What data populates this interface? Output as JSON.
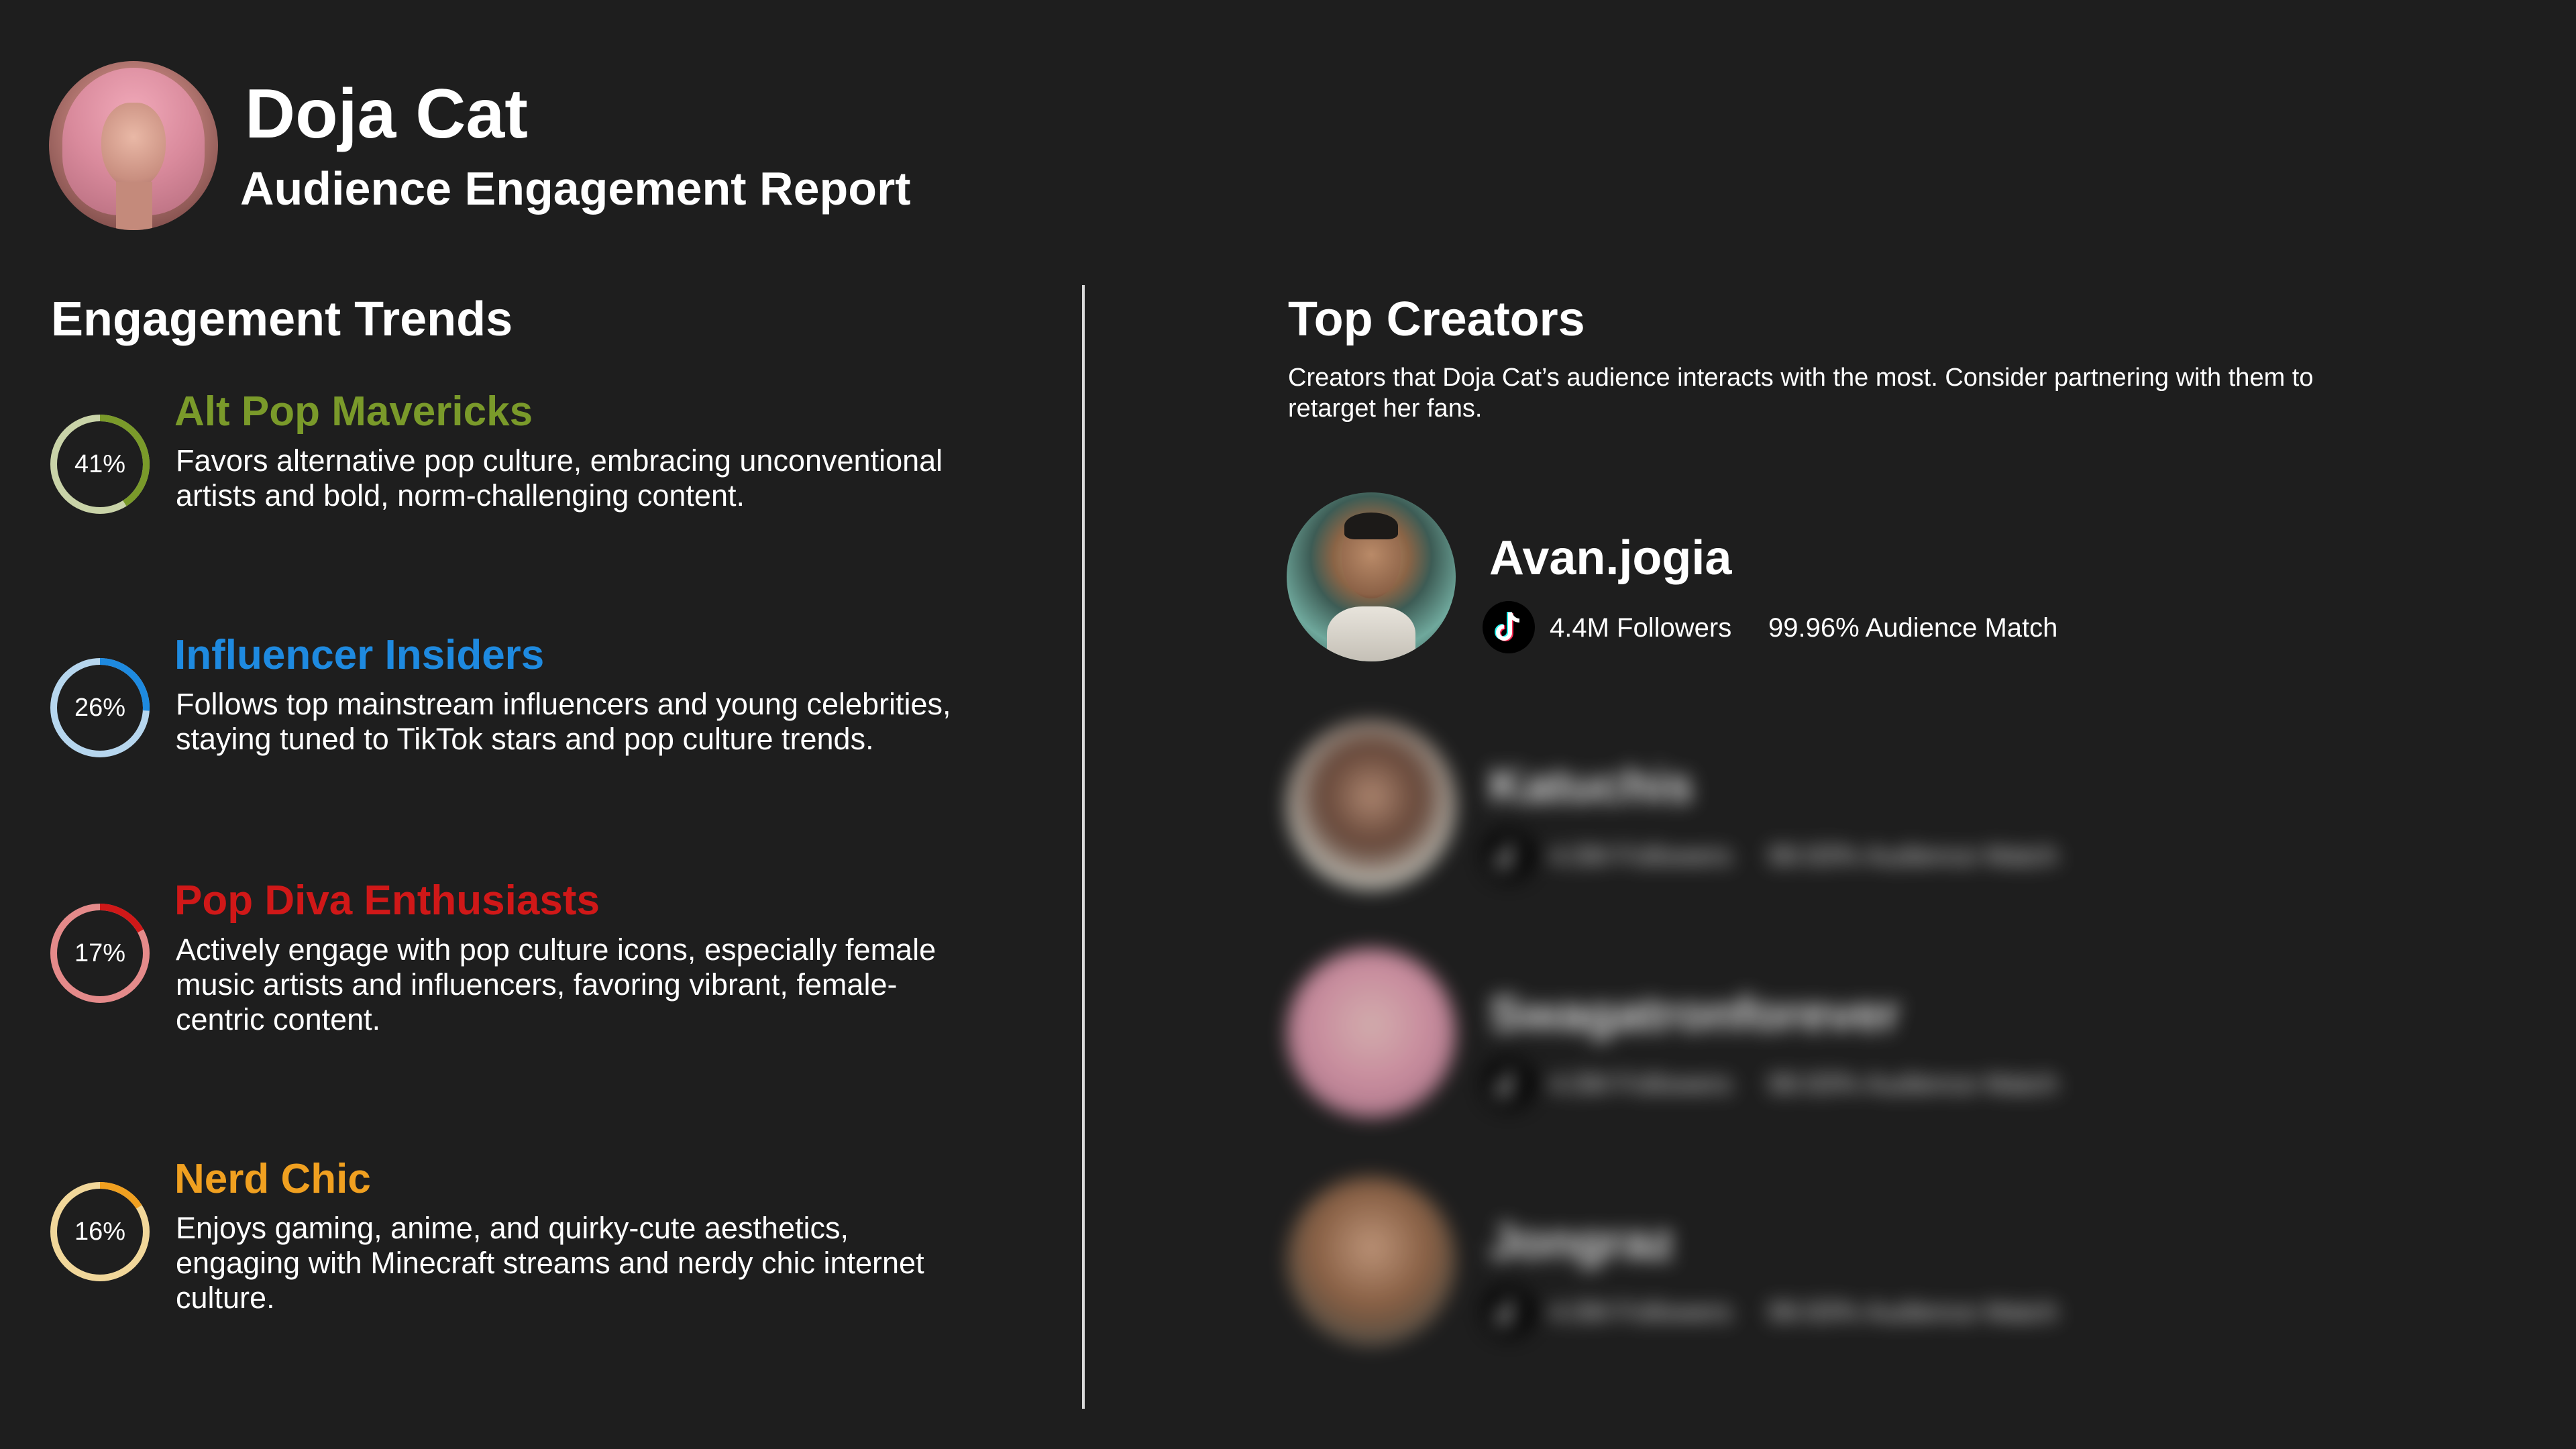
{
  "header": {
    "title": "Doja Cat",
    "subtitle": "Audience Engagement Report"
  },
  "trends": {
    "section_title": "Engagement Trends",
    "items": [
      {
        "name": "Alt Pop Mavericks",
        "percent_label": "41%",
        "percent": 41,
        "color": "#7a9a2a",
        "track_color": "#c9d3a8",
        "description": "Favors alternative pop culture, embracing unconventional artists and bold, norm-challenging content."
      },
      {
        "name": "Influencer Insiders",
        "percent_label": "26%",
        "percent": 26,
        "color": "#1e8ae0",
        "track_color": "#b6d6ee",
        "description": "Follows top mainstream influencers and young celebrities, staying tuned to TikTok stars and pop culture trends."
      },
      {
        "name": "Pop Diva Enthusiasts",
        "percent_label": "17%",
        "percent": 17,
        "color": "#d01818",
        "track_color": "#e48a8a",
        "description": "Actively engage with pop culture icons, especially female music artists and influencers, favoring vibrant, female-centric content."
      },
      {
        "name": "Nerd Chic",
        "percent_label": "16%",
        "percent": 16,
        "color": "#f0a020",
        "track_color": "#f1d79a",
        "description": "Enjoys gaming, anime, and quirky-cute aesthetics, engaging with Minecraft streams and nerdy chic internet culture."
      }
    ]
  },
  "creators": {
    "section_title": "Top Creators",
    "description": "Creators that Doja Cat’s audience interacts with the most. Consider partnering with them to retarget her fans.",
    "items": [
      {
        "name": "Avan.jogia",
        "followers": "4.4M Followers",
        "match": "99.96% Audience Match",
        "platform_icon": "tiktok-icon",
        "blurred": false
      },
      {
        "name": "Katuchis",
        "followers": "4.0M Followers",
        "match": "99.93% Audience Match",
        "platform_icon": "tiktok-icon",
        "blurred": true
      },
      {
        "name": "Swagatronforever",
        "followers": "4.0M Followers",
        "match": "99.93% Audience Match",
        "platform_icon": "tiktok-icon",
        "blurred": true
      },
      {
        "name": "Jongraz",
        "followers": "4.0M Followers",
        "match": "99.93% Audience Match",
        "platform_icon": "tiktok-icon",
        "blurred": true
      }
    ]
  }
}
